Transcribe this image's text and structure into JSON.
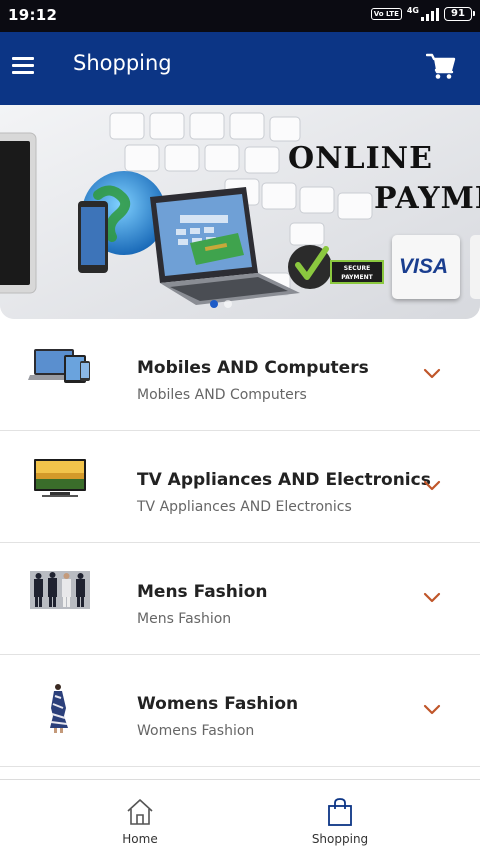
{
  "status_bar": {
    "time": "19:12",
    "volte": "Vo LTE",
    "network": "4G",
    "battery": "91"
  },
  "app_bar": {
    "title": "Shopping",
    "menu_icon": "hamburger-menu-icon",
    "cart_icon": "shopping-cart-icon"
  },
  "banner": {
    "title_line_1": "ONLINE",
    "title_line_2": "PAYME",
    "badge_text": "SECURE PAYMENT",
    "card_text": "VISA",
    "slides": 2,
    "active_slide": 1
  },
  "categories": [
    {
      "title": "Mobiles AND Computers",
      "subtitle": "Mobiles AND Computers",
      "thumb": "devices-thumbnail"
    },
    {
      "title": "TV Appliances AND Electronics",
      "subtitle": "TV Appliances AND Electronics",
      "thumb": "tv-thumbnail"
    },
    {
      "title": "Mens Fashion",
      "subtitle": "Mens Fashion",
      "thumb": "mens-fashion-thumbnail"
    },
    {
      "title": "Womens Fashion",
      "subtitle": "Womens Fashion",
      "thumb": "womens-fashion-thumbnail"
    }
  ],
  "bottom_nav": {
    "items": [
      {
        "label": "Home",
        "icon": "home-icon"
      },
      {
        "label": "Shopping",
        "icon": "shopping-bag-icon"
      }
    ]
  },
  "colors": {
    "app_bar": "#0c3585",
    "status_bar": "#0b0b12",
    "chevron": "#c0562a",
    "active_dot": "#1e5cc7"
  }
}
